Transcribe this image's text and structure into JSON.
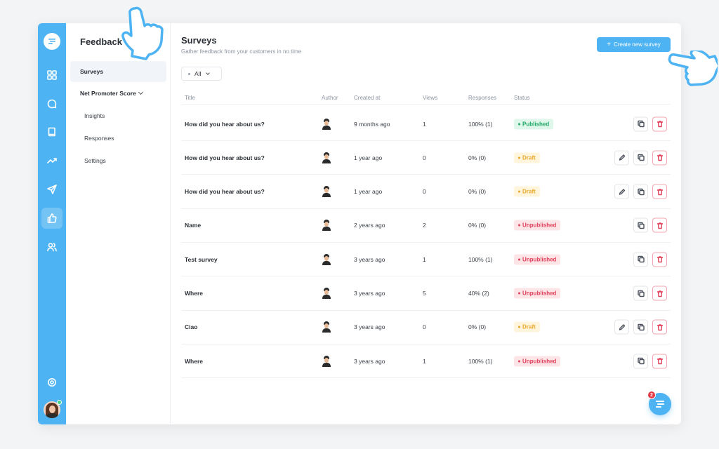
{
  "colors": {
    "accent": "#4db3f2",
    "published": "#1ea866",
    "draft": "#e8a92a",
    "unpublished": "#e0415a"
  },
  "rail": {
    "icons": [
      "chat-logo-icon",
      "dashboard-icon",
      "conversations-icon",
      "knowledge-base-icon",
      "reports-icon",
      "campaigns-icon",
      "feedback-icon",
      "contacts-icon",
      "settings-icon"
    ],
    "active": "feedback-icon"
  },
  "subnav": {
    "title": "Feedback",
    "items": [
      {
        "label": "Surveys",
        "active": true
      },
      {
        "label": "Net Promoter Score"
      },
      {
        "label": "Insights"
      },
      {
        "label": "Responses"
      },
      {
        "label": "Settings"
      }
    ]
  },
  "header": {
    "title": "Surveys",
    "subtitle": "Gather feedback from your customers in no time",
    "create_label": "Create new survey"
  },
  "filter": {
    "selected": "All"
  },
  "table": {
    "columns": [
      "Title",
      "Author",
      "Created at",
      "Views",
      "Responses",
      "Status"
    ],
    "rows": [
      {
        "title": "How did you hear about us?",
        "created": "9 months ago",
        "views": "1",
        "responses": "100% (1)",
        "status": "Published",
        "editable": false
      },
      {
        "title": "How did you hear about us?",
        "created": "1 year ago",
        "views": "0",
        "responses": "0% (0)",
        "status": "Draft",
        "editable": true
      },
      {
        "title": "How did you hear about us?",
        "created": "1 year ago",
        "views": "0",
        "responses": "0% (0)",
        "status": "Draft",
        "editable": true
      },
      {
        "title": "Name",
        "created": "2 years ago",
        "views": "2",
        "responses": "0% (0)",
        "status": "Unpublished",
        "editable": false
      },
      {
        "title": "Test survey",
        "created": "3 years ago",
        "views": "1",
        "responses": "100% (1)",
        "status": "Unpublished",
        "editable": false
      },
      {
        "title": "Where",
        "created": "3 years ago",
        "views": "5",
        "responses": "40% (2)",
        "status": "Unpublished",
        "editable": false
      },
      {
        "title": "Ciao",
        "created": "3 years ago",
        "views": "0",
        "responses": "0% (0)",
        "status": "Draft",
        "editable": true
      },
      {
        "title": "Where",
        "created": "3 years ago",
        "views": "1",
        "responses": "100% (1)",
        "status": "Unpublished",
        "editable": false
      }
    ]
  },
  "chat": {
    "badge_count": "2"
  }
}
